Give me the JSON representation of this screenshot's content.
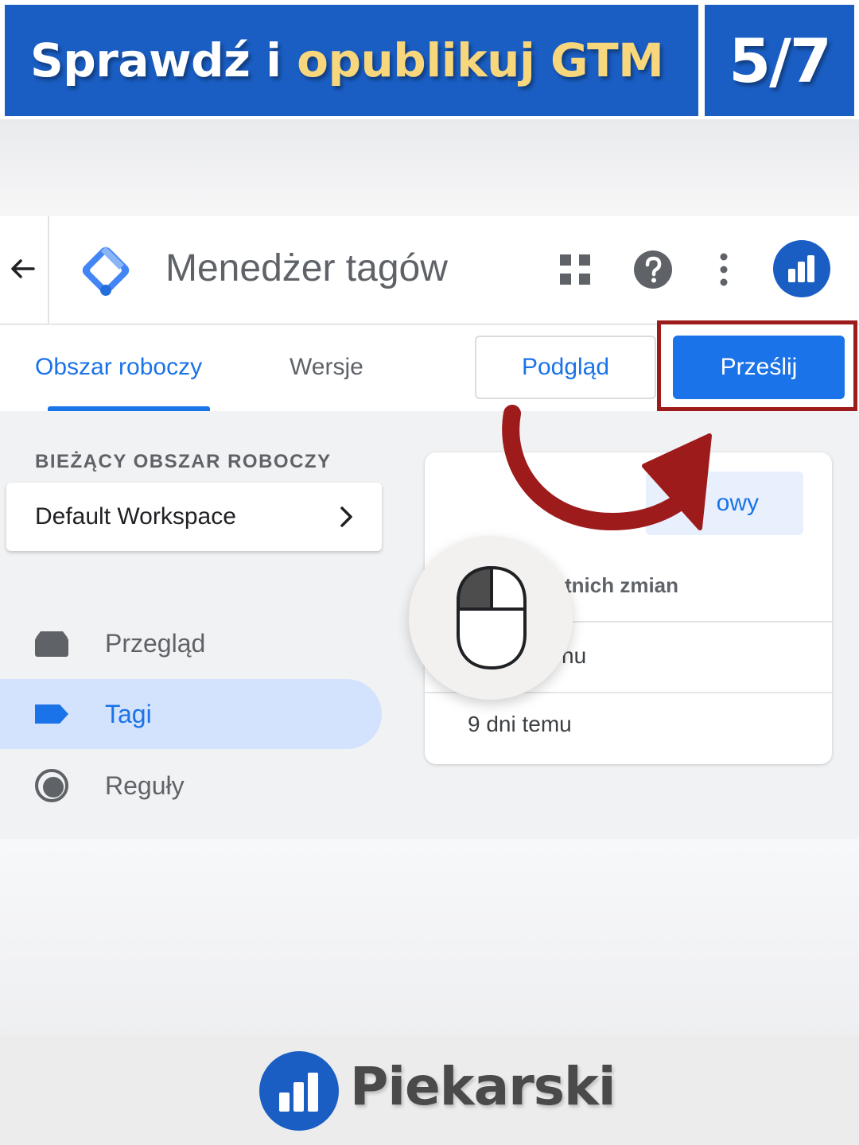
{
  "banner": {
    "title_part1": "Sprawdź i ",
    "title_part2": "opublikuj GTM",
    "step": "5/7",
    "colors": {
      "background": "#1a5ec4",
      "highlight": "#f8d77c"
    }
  },
  "appbar": {
    "back_icon": "arrow-back-icon",
    "logo_icon": "gtm-diamond-icon",
    "title": "Menedżer tagów",
    "icons": [
      "apps-grid-icon",
      "help-icon",
      "more-vert-icon",
      "account-avatar-icon"
    ]
  },
  "tabs": [
    {
      "label": "Obszar roboczy",
      "active": true
    },
    {
      "label": "Wersje",
      "active": false
    }
  ],
  "actions": {
    "preview_label": "Podgląd",
    "submit_label": "Prześlij"
  },
  "sidebar": {
    "section_label": "BIEŻĄCY OBSZAR ROBOCZY",
    "workspace_name": "Default Workspace",
    "items": [
      {
        "label": "Przegląd",
        "icon": "folder-icon",
        "active": false
      },
      {
        "label": "Tagi",
        "icon": "tag-icon",
        "active": true
      },
      {
        "label": "Reguły",
        "icon": "trigger-icon",
        "active": false
      }
    ]
  },
  "panel": {
    "chip_label": "owy",
    "changes_text": "tnich zmian",
    "row1_text": "nu",
    "row2_text": "9 dni temu"
  },
  "annotation": {
    "arrow_icon": "curved-arrow-icon",
    "mouse_icon": "mouse-left-click-icon",
    "highlight_color": "#9e1b1b"
  },
  "footer": {
    "logo_icon": "bar-chart-logo-icon",
    "brand_name": "Piekarski"
  }
}
